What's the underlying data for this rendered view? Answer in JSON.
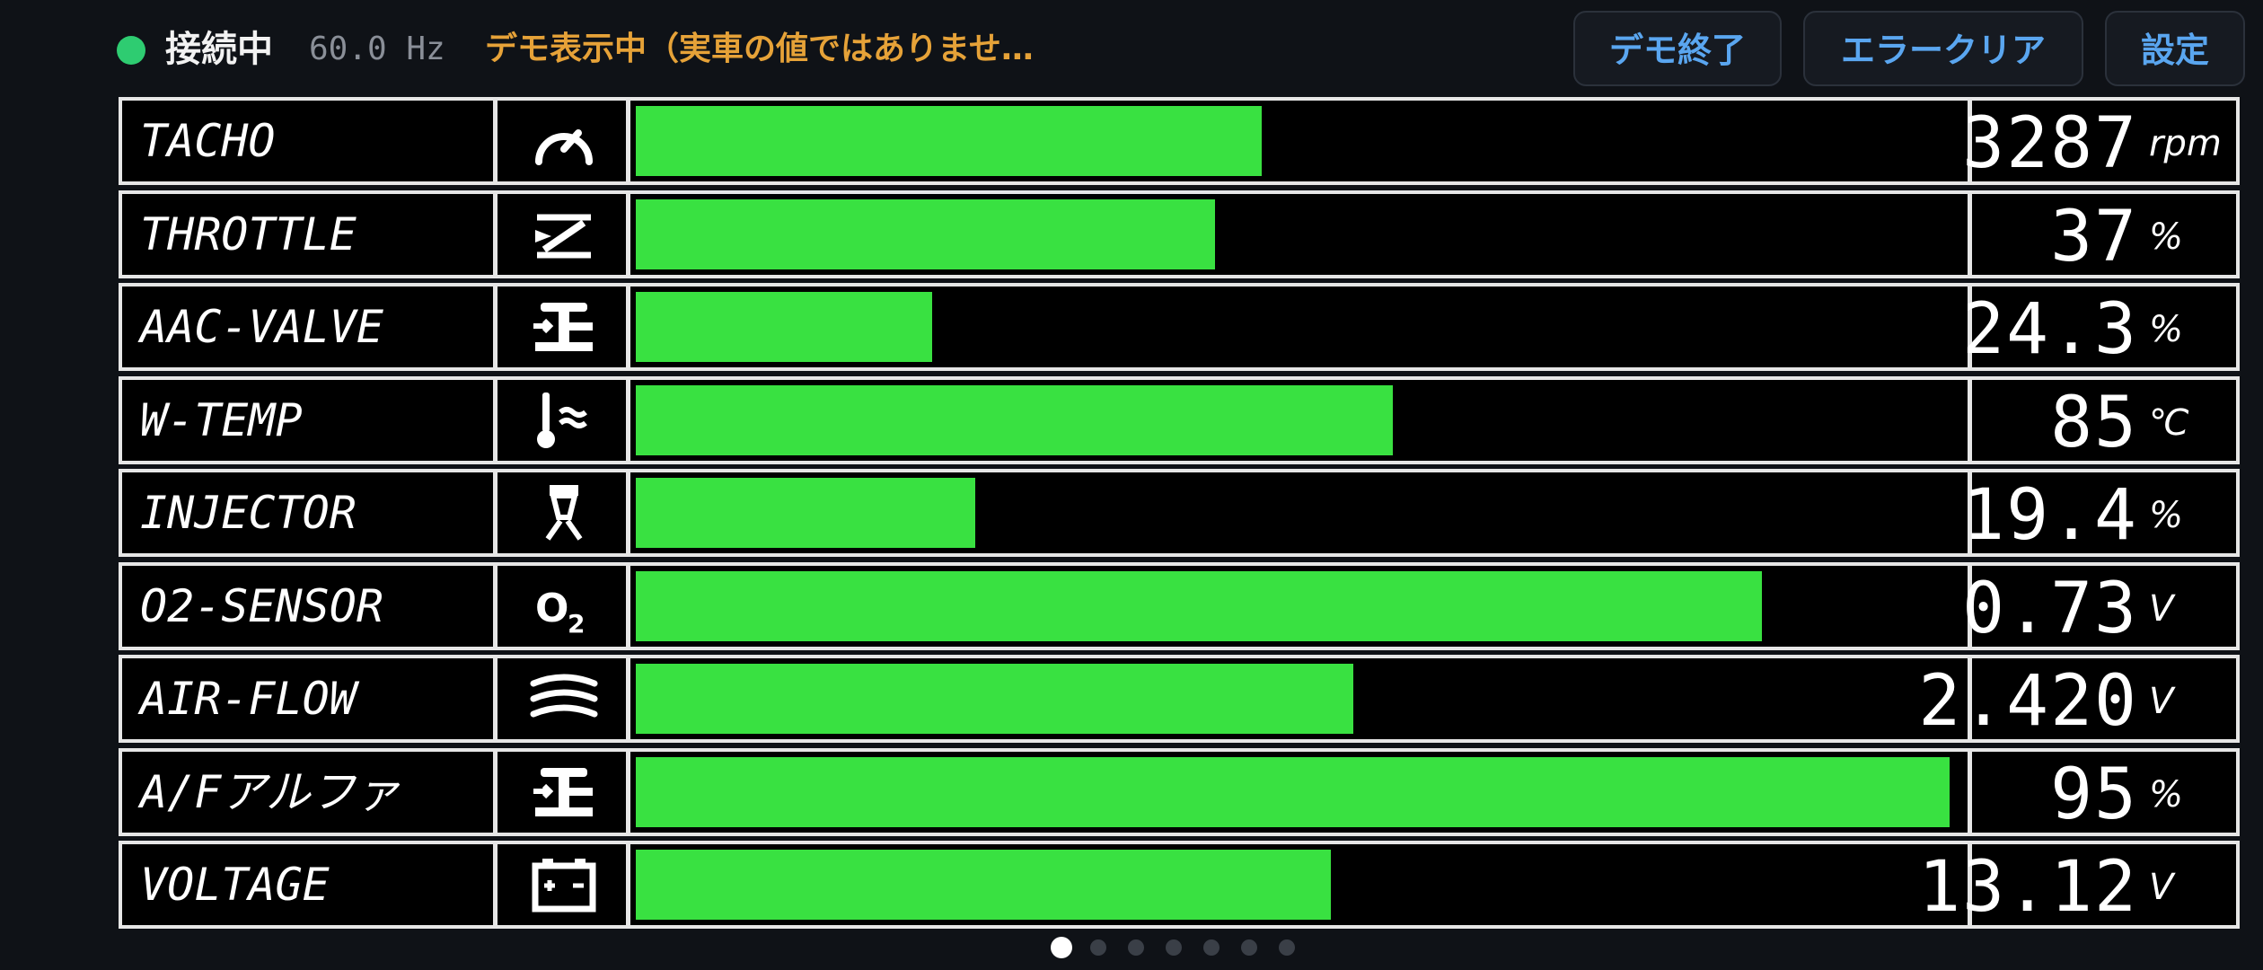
{
  "header": {
    "status_label": "接続中",
    "frequency": "60.0 Hz",
    "demo_banner": "デモ表示中（実車の値ではありませ…",
    "status_color": "#2ecc71",
    "buttons": {
      "demo_end": "デモ終了",
      "error_clear": "エラークリア",
      "settings": "設定"
    }
  },
  "bar_color": "#39e141",
  "rows": [
    {
      "name": "TACHO",
      "icon": "tachometer-icon",
      "value": "3287",
      "unit": "rpm",
      "level": 0.47
    },
    {
      "name": "THROTTLE",
      "icon": "throttle-icon",
      "value": "37",
      "unit": "%",
      "level": 0.435
    },
    {
      "name": "AAC-VALVE",
      "icon": "valve-icon",
      "value": "24.3",
      "unit": "%",
      "level": 0.223
    },
    {
      "name": "W-TEMP",
      "icon": "coolant-temp-icon",
      "value": "85",
      "unit": "℃",
      "level": 0.569
    },
    {
      "name": "INJECTOR",
      "icon": "injector-icon",
      "value": "19.4",
      "unit": "%",
      "level": 0.255
    },
    {
      "name": "O2-SENSOR",
      "icon": "o2-sensor-icon",
      "value": "0.73",
      "unit": "V",
      "level": 0.846
    },
    {
      "name": "AIR-FLOW",
      "icon": "air-flow-icon",
      "value": "2.420",
      "unit": "V",
      "level": 0.539
    },
    {
      "name": "A/Fアルファ",
      "icon": "valve-icon",
      "value": "95",
      "unit": "%",
      "level": 0.987
    },
    {
      "name": "VOLTAGE",
      "icon": "battery-icon",
      "value": "13.12",
      "unit": "V",
      "level": 0.522
    }
  ],
  "pager": {
    "count": 7,
    "active": 0
  }
}
